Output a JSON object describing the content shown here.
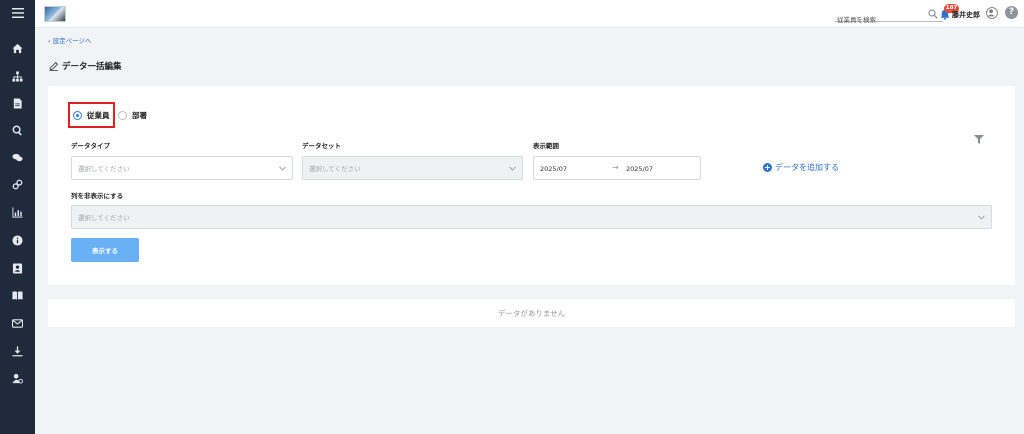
{
  "header": {
    "search_placeholder": "従業員を検索",
    "notification_count": "187",
    "user_name": "藤井史郎",
    "help_label": "?"
  },
  "sidebar": {
    "items": [
      {
        "icon": "home-icon"
      },
      {
        "icon": "org-chart-icon"
      },
      {
        "icon": "document-icon"
      },
      {
        "icon": "search-icon"
      },
      {
        "icon": "chat-icon"
      },
      {
        "icon": "link-icon"
      },
      {
        "icon": "bar-chart-icon"
      },
      {
        "icon": "info-icon"
      },
      {
        "icon": "contact-card-icon"
      },
      {
        "icon": "book-icon"
      },
      {
        "icon": "mail-icon"
      },
      {
        "icon": "download-icon"
      },
      {
        "icon": "user-settings-icon"
      }
    ]
  },
  "breadcrumb": {
    "back_label": "設定ページへ"
  },
  "page": {
    "title": "データ一括編集"
  },
  "form": {
    "radio_employee": "従業員",
    "radio_department": "部署",
    "selected": "employee",
    "data_type_label": "データタイプ",
    "data_type_placeholder": "選択してください",
    "dataset_label": "データセット",
    "dataset_placeholder": "選択してください",
    "range_label": "表示範囲",
    "range_start": "2025/07",
    "range_arrow": "→",
    "range_end": "2025/07",
    "add_data_label": "データを追加する",
    "hide_columns_label": "列を非表示にする",
    "hide_columns_placeholder": "選択してください",
    "show_button": "表示する"
  },
  "results": {
    "empty_message": "データがありません"
  },
  "colors": {
    "sidebar_bg": "#1f2a3c",
    "accent": "#2f73c8",
    "button": "#6ab0f5",
    "highlight_border": "#e32020",
    "badge": "#e64c3c"
  }
}
